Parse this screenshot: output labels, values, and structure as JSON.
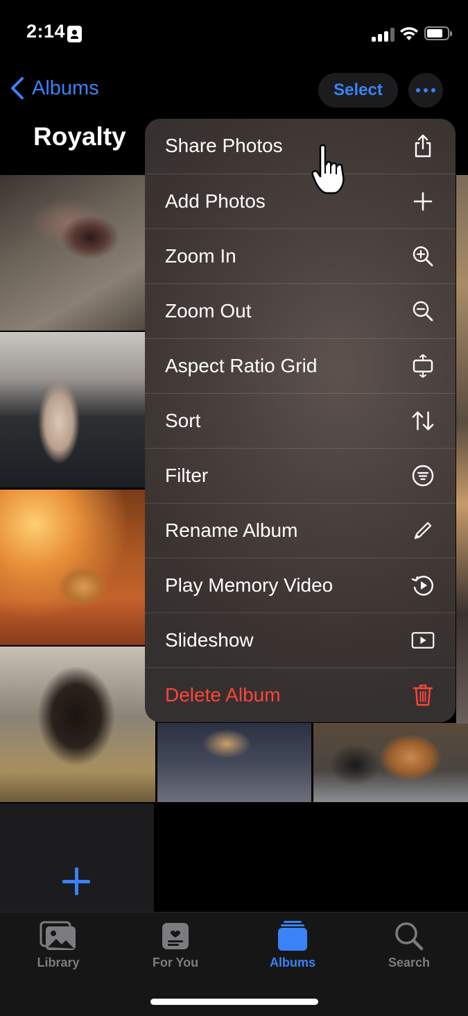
{
  "status_bar": {
    "time": "2:14"
  },
  "nav": {
    "back_label": "Albums",
    "select_label": "Select"
  },
  "album": {
    "title": "Royalty"
  },
  "menu": {
    "items": [
      {
        "label": "Share Photos",
        "icon": "share-icon"
      },
      {
        "label": "Add Photos",
        "icon": "plus-icon"
      },
      {
        "label": "Zoom In",
        "icon": "zoom-in-icon"
      },
      {
        "label": "Zoom Out",
        "icon": "zoom-out-icon"
      },
      {
        "label": "Aspect Ratio Grid",
        "icon": "aspect-ratio-icon"
      },
      {
        "label": "Sort",
        "icon": "sort-arrows-icon"
      },
      {
        "label": "Filter",
        "icon": "filter-icon"
      },
      {
        "label": "Rename Album",
        "icon": "pencil-icon"
      },
      {
        "label": "Play Memory Video",
        "icon": "memory-video-icon"
      },
      {
        "label": "Slideshow",
        "icon": "play-rectangle-icon"
      },
      {
        "label": "Delete Album",
        "icon": "trash-icon",
        "destructive": true
      }
    ]
  },
  "tabbar": {
    "tabs": [
      {
        "label": "Library",
        "icon": "photo-library-icon"
      },
      {
        "label": "For You",
        "icon": "for-you-icon"
      },
      {
        "label": "Albums",
        "icon": "albums-icon",
        "active": true
      },
      {
        "label": "Search",
        "icon": "search-icon"
      }
    ]
  },
  "colors": {
    "accent": "#3a82f7",
    "destructive": "#ff453a",
    "background": "#000000"
  }
}
